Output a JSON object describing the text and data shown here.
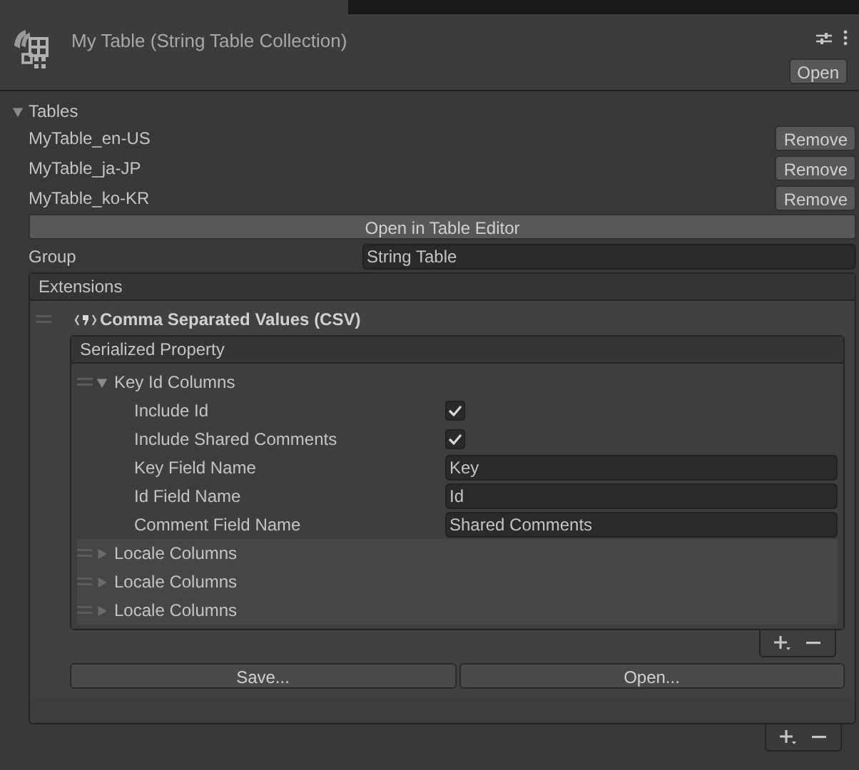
{
  "header": {
    "title": "My Table (String Table Collection)",
    "open_button": "Open"
  },
  "tables": {
    "label": "Tables",
    "expanded": true,
    "items": [
      {
        "name": "MyTable_en-US",
        "button": "Remove"
      },
      {
        "name": "MyTable_ja-JP",
        "button": "Remove"
      },
      {
        "name": "MyTable_ko-KR",
        "button": "Remove"
      }
    ],
    "editor_button": "Open in Table Editor"
  },
  "group": {
    "label": "Group",
    "value": "String Table"
  },
  "extensions": {
    "label": "Extensions",
    "item": {
      "title": "Comma Separated Values (CSV)",
      "panel_title": "Serialized Property",
      "columns": [
        {
          "label": "Key Id Columns",
          "expanded": true,
          "fields": [
            {
              "kind": "checkbox",
              "label": "Include Id",
              "checked": true
            },
            {
              "kind": "checkbox",
              "label": "Include Shared Comments",
              "checked": true
            },
            {
              "kind": "text",
              "label": "Key Field Name",
              "value": "Key"
            },
            {
              "kind": "text",
              "label": "Id Field Name",
              "value": "Id"
            },
            {
              "kind": "text",
              "label": "Comment Field Name",
              "value": "Shared Comments"
            }
          ]
        },
        {
          "label": "Locale Columns",
          "expanded": false
        },
        {
          "label": "Locale Columns",
          "expanded": false
        },
        {
          "label": "Locale Columns",
          "expanded": false
        }
      ],
      "buttons": [
        "Save...",
        "Open..."
      ]
    }
  }
}
